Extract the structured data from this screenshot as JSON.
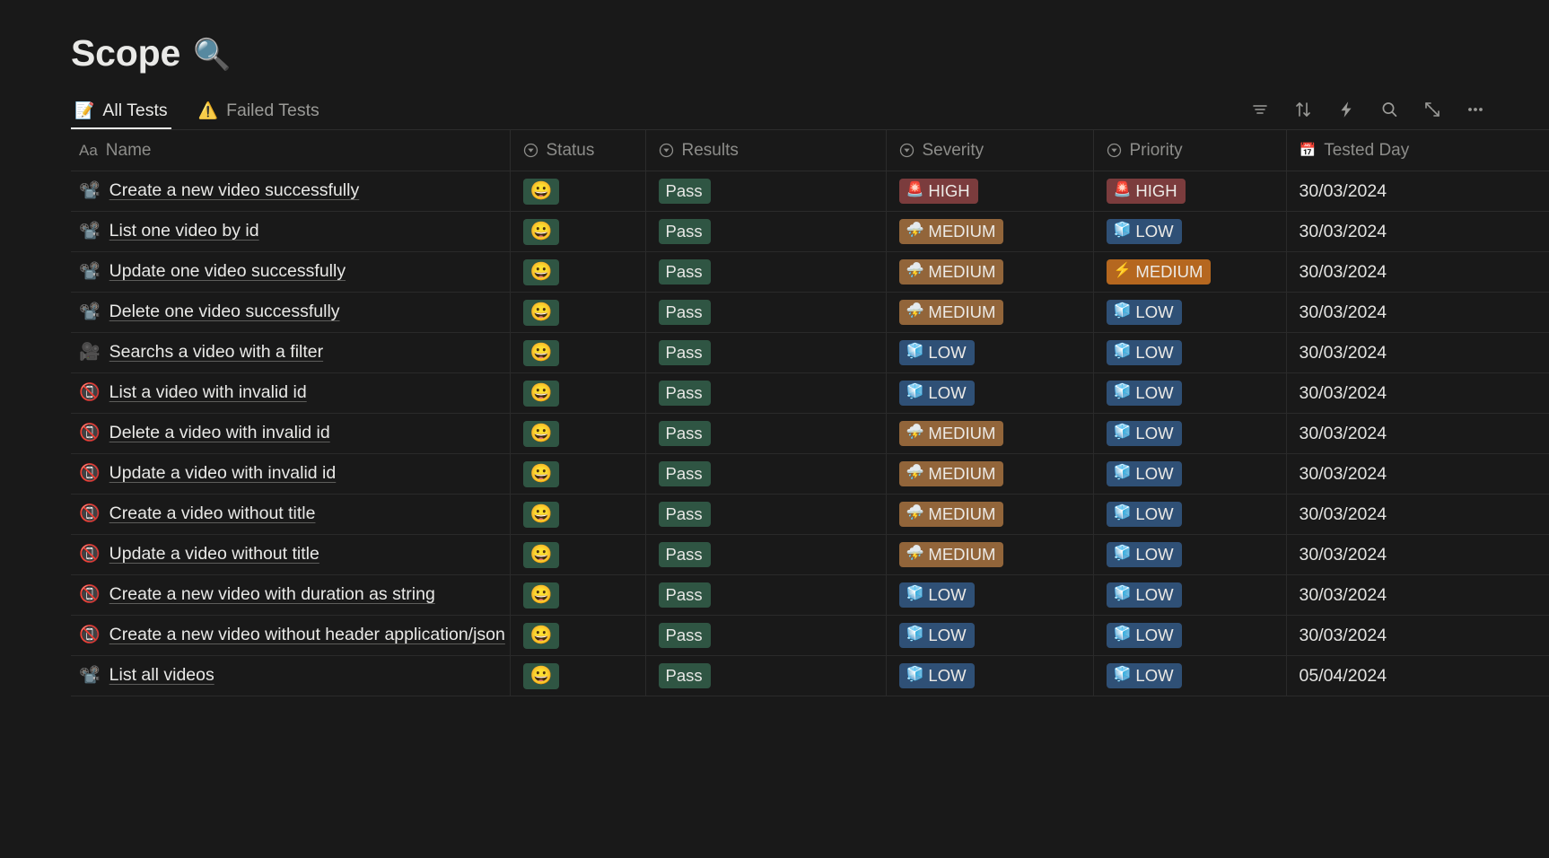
{
  "header": {
    "title": "Scope",
    "title_emoji": "🔍",
    "title_emoji_name": "magnifying-glass-icon"
  },
  "tabs": [
    {
      "label": "All Tests",
      "icon": "📝",
      "icon_name": "edit-note-icon",
      "active": true
    },
    {
      "label": "Failed Tests",
      "icon": "⚠️",
      "icon_name": "warning-triangle-icon",
      "active": false
    }
  ],
  "toolbar": [
    {
      "name": "filter-icon",
      "label": "Filter"
    },
    {
      "name": "sort-icon",
      "label": "Sort"
    },
    {
      "name": "lightning-automation-icon",
      "label": "Automations"
    },
    {
      "name": "search-icon",
      "label": "Search"
    },
    {
      "name": "expand-icon",
      "label": "Expand"
    },
    {
      "name": "more-options-icon",
      "label": "More options"
    }
  ],
  "table": {
    "columns": [
      {
        "key": "name",
        "label": "Name",
        "icon": "Aa",
        "icon_name": "text-type-icon"
      },
      {
        "key": "status",
        "label": "Status",
        "icon": "▼",
        "icon_name": "select-type-icon"
      },
      {
        "key": "results",
        "label": "Results",
        "icon": "▼",
        "icon_name": "select-type-icon"
      },
      {
        "key": "severity",
        "label": "Severity",
        "icon": "▼",
        "icon_name": "select-type-icon"
      },
      {
        "key": "priority",
        "label": "Priority",
        "icon": "▼",
        "icon_name": "select-type-icon"
      },
      {
        "key": "tested",
        "label": "Tested Day",
        "icon": "📅",
        "icon_name": "calendar-icon"
      }
    ],
    "rows": [
      {
        "icon": "📽️",
        "icon_name": "film-projector-icon",
        "name": "Create a new video successfully",
        "status_emoji": "😀",
        "results": "Pass",
        "severity": "HIGH",
        "severity_emoji": "🚨",
        "severity_class": "high",
        "priority": "HIGH",
        "priority_emoji": "🚨",
        "priority_class": "high",
        "tested": "30/03/2024"
      },
      {
        "icon": "📽️",
        "icon_name": "film-projector-icon",
        "name": "List one video by id",
        "status_emoji": "😀",
        "results": "Pass",
        "severity": "MEDIUM",
        "severity_emoji": "⛈️",
        "severity_class": "med",
        "priority": "LOW",
        "priority_emoji": "🧊",
        "priority_class": "low",
        "tested": "30/03/2024"
      },
      {
        "icon": "📽️",
        "icon_name": "film-projector-icon",
        "name": "Update one video successfully",
        "status_emoji": "😀",
        "results": "Pass",
        "severity": "MEDIUM",
        "severity_emoji": "⛈️",
        "severity_class": "med",
        "priority": "MEDIUM",
        "priority_emoji": "⚡",
        "priority_class": "medp",
        "tested": "30/03/2024"
      },
      {
        "icon": "📽️",
        "icon_name": "film-projector-icon",
        "name": "Delete one video successfully",
        "status_emoji": "😀",
        "results": "Pass",
        "severity": "MEDIUM",
        "severity_emoji": "⛈️",
        "severity_class": "med",
        "priority": "LOW",
        "priority_emoji": "🧊",
        "priority_class": "low",
        "tested": "30/03/2024"
      },
      {
        "icon": "🎥",
        "icon_name": "movie-camera-icon",
        "name": "Searchs a video with a filter",
        "status_emoji": "😀",
        "results": "Pass",
        "severity": "LOW",
        "severity_emoji": "🧊",
        "severity_class": "low",
        "priority": "LOW",
        "priority_emoji": "🧊",
        "priority_class": "low",
        "tested": "30/03/2024"
      },
      {
        "icon": "📵",
        "icon_name": "no-video-camera-icon",
        "name": "List a video with invalid id",
        "status_emoji": "😀",
        "results": "Pass",
        "severity": "LOW",
        "severity_emoji": "🧊",
        "severity_class": "low",
        "priority": "LOW",
        "priority_emoji": "🧊",
        "priority_class": "low",
        "tested": "30/03/2024"
      },
      {
        "icon": "📵",
        "icon_name": "no-video-camera-icon",
        "name": "Delete a video with invalid id",
        "status_emoji": "😀",
        "results": "Pass",
        "severity": "MEDIUM",
        "severity_emoji": "⛈️",
        "severity_class": "med",
        "priority": "LOW",
        "priority_emoji": "🧊",
        "priority_class": "low",
        "tested": "30/03/2024"
      },
      {
        "icon": "📵",
        "icon_name": "no-video-camera-icon",
        "name": "Update a video with invalid id",
        "status_emoji": "😀",
        "results": "Pass",
        "severity": "MEDIUM",
        "severity_emoji": "⛈️",
        "severity_class": "med",
        "priority": "LOW",
        "priority_emoji": "🧊",
        "priority_class": "low",
        "tested": "30/03/2024"
      },
      {
        "icon": "📵",
        "icon_name": "no-video-camera-icon",
        "name": "Create a video without title",
        "status_emoji": "😀",
        "results": "Pass",
        "severity": "MEDIUM",
        "severity_emoji": "⛈️",
        "severity_class": "med",
        "priority": "LOW",
        "priority_emoji": "🧊",
        "priority_class": "low",
        "tested": "30/03/2024"
      },
      {
        "icon": "📵",
        "icon_name": "no-video-camera-icon",
        "name": "Update a video without title",
        "status_emoji": "😀",
        "results": "Pass",
        "severity": "MEDIUM",
        "severity_emoji": "⛈️",
        "severity_class": "med",
        "priority": "LOW",
        "priority_emoji": "🧊",
        "priority_class": "low",
        "tested": "30/03/2024"
      },
      {
        "icon": "📵",
        "icon_name": "no-video-camera-icon",
        "name": "Create a new video with duration as string",
        "status_emoji": "😀",
        "results": "Pass",
        "severity": "LOW",
        "severity_emoji": "🧊",
        "severity_class": "low",
        "priority": "LOW",
        "priority_emoji": "🧊",
        "priority_class": "low",
        "tested": "30/03/2024"
      },
      {
        "icon": "📵",
        "icon_name": "no-video-camera-icon",
        "name": "Create a new video without header application/json",
        "status_emoji": "😀",
        "results": "Pass",
        "severity": "LOW",
        "severity_emoji": "🧊",
        "severity_class": "low",
        "priority": "LOW",
        "priority_emoji": "🧊",
        "priority_class": "low",
        "tested": "30/03/2024"
      },
      {
        "icon": "📽️",
        "icon_name": "film-projector-icon",
        "name": "List all videos",
        "status_emoji": "😀",
        "results": "Pass",
        "severity": "LOW",
        "severity_emoji": "🧊",
        "severity_class": "low",
        "priority": "LOW",
        "priority_emoji": "🧊",
        "priority_class": "low",
        "tested": "05/04/2024"
      }
    ]
  },
  "colors": {
    "page_bg": "#191919",
    "chip_green": "#2f5543",
    "chip_high_red": "#7b3c3d",
    "chip_medium_tan": "#92653a",
    "chip_medium_orange": "#b5671f",
    "chip_low_blue": "#2f5076"
  }
}
